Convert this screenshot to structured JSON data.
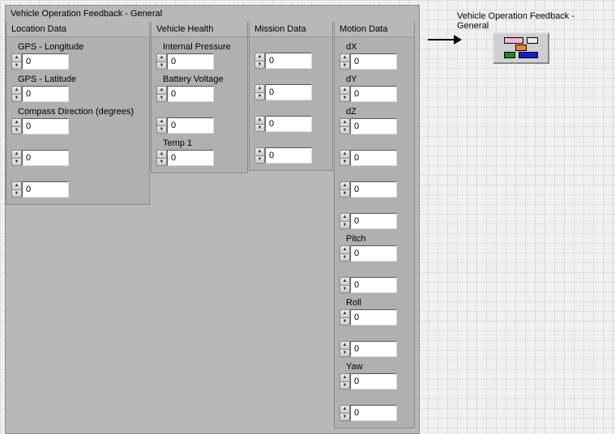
{
  "panel_title": "Vehicle Operation Feedback - General",
  "location": {
    "header": "Location Data",
    "fields": [
      {
        "label": "GPS - Longitude",
        "value": "0"
      },
      {
        "label": "GPS - Latitude",
        "value": "0"
      },
      {
        "label": "Compass Direction (degrees)",
        "value": "0"
      },
      {
        "label": "",
        "value": "0"
      },
      {
        "label": "",
        "value": "0"
      }
    ]
  },
  "vehicle_health": {
    "header": "Vehicle Health",
    "fields": [
      {
        "label": "Internal Pressure",
        "value": "0"
      },
      {
        "label": "Battery Voltage",
        "value": "0"
      },
      {
        "label": "",
        "value": "0"
      },
      {
        "label": "Temp 1",
        "value": "0"
      }
    ]
  },
  "mission": {
    "header": "Mission Data",
    "fields": [
      {
        "label": "",
        "value": "0"
      },
      {
        "label": "",
        "value": "0"
      },
      {
        "label": "",
        "value": "0"
      },
      {
        "label": "",
        "value": "0"
      }
    ]
  },
  "motion": {
    "header": "Motion Data",
    "fields": [
      {
        "label": "dX",
        "value": "0"
      },
      {
        "label": "dY",
        "value": "0"
      },
      {
        "label": "dZ",
        "value": "0"
      },
      {
        "label": "",
        "value": "0"
      },
      {
        "label": "",
        "value": "0"
      },
      {
        "label": "",
        "value": "0"
      },
      {
        "label": "Pitch",
        "value": "0"
      },
      {
        "label": "",
        "value": "0"
      },
      {
        "label": "Roll",
        "value": "0"
      },
      {
        "label": "",
        "value": "0"
      },
      {
        "label": "Yaw",
        "value": "0"
      },
      {
        "label": "",
        "value": "0"
      }
    ]
  },
  "icon_panel_title": "Vehicle Operation Feedback - General"
}
